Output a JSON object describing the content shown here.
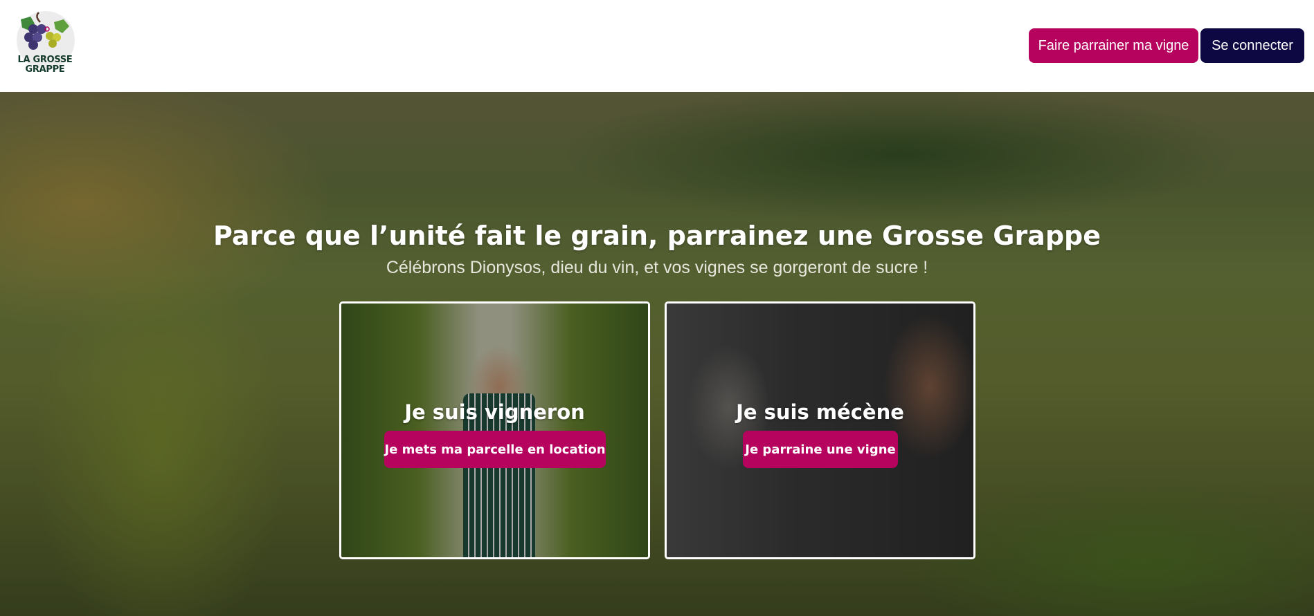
{
  "header": {
    "logo_text_line1": "LA GROSSE",
    "logo_text_line2": "GRAPPE",
    "sponsor_button_label": "Faire parrainer ma vigne",
    "login_button_label": "Se connecter"
  },
  "hero": {
    "title": "Parce que l’unité fait le grain, parrainez une Grosse Grappe",
    "subtitle": "Célébrons Dionysos, dieu du vin, et vos vignes se gorgeront de sucre !"
  },
  "cards": [
    {
      "title": "Je suis vigneron",
      "button_label": "Je mets ma parcelle en location"
    },
    {
      "title": "Je suis mécène",
      "button_label": "Je parraine une vigne"
    }
  ],
  "colors": {
    "brand_primary": "#b5035e",
    "brand_dark": "#0d0742",
    "logo_green": "#143a2b"
  }
}
